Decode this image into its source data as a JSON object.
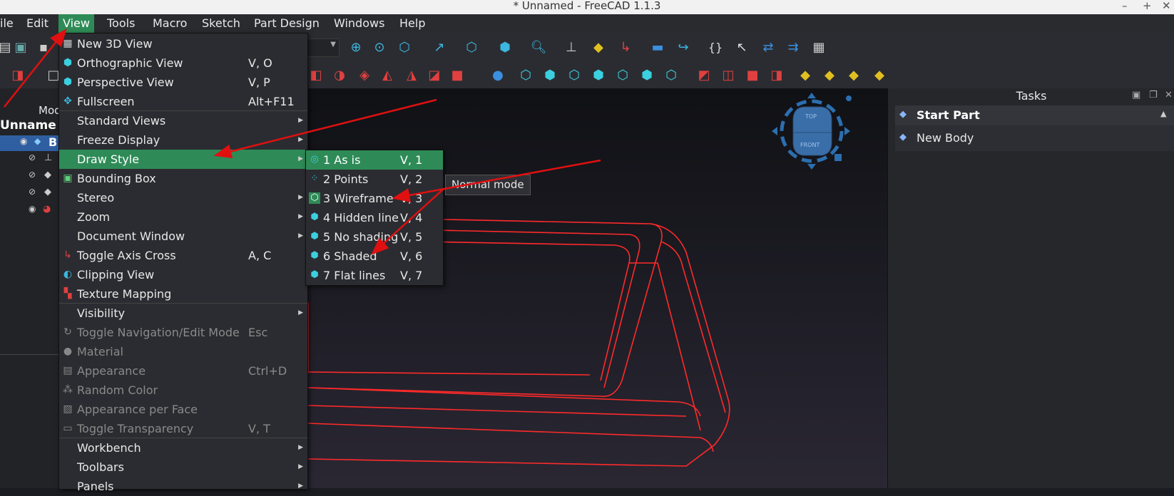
{
  "window": {
    "title": "* Unnamed - FreeCAD 1.1.3"
  },
  "menubar": {
    "items": [
      "ile",
      "Edit",
      "View",
      "Tools",
      "Macro",
      "Sketch",
      "Part Design",
      "Windows",
      "Help"
    ]
  },
  "left_panel": {
    "tab_fragment": "Mod",
    "doc_label": "Unname",
    "row_label": "B"
  },
  "tasks": {
    "header": "Tasks",
    "section_title": "Start Part",
    "action": "New Body"
  },
  "navcube": {
    "top_label": "TOP",
    "front_label": "FRONT"
  },
  "view_menu": {
    "items": [
      {
        "label": "New 3D View",
        "shortcut": "",
        "icon": "new-3d-view-icon",
        "disabled": false,
        "submenu": false
      },
      {
        "label": "Orthographic View",
        "shortcut": "V, O",
        "icon": "cube-icon",
        "disabled": false,
        "submenu": false
      },
      {
        "label": "Perspective View",
        "shortcut": "V, P",
        "icon": "cube-icon",
        "disabled": false,
        "submenu": false
      },
      {
        "label": "Fullscreen",
        "shortcut": "Alt+F11",
        "icon": "fullscreen-icon",
        "disabled": false,
        "submenu": false
      },
      {
        "label": "Standard Views",
        "shortcut": "",
        "icon": "",
        "disabled": false,
        "submenu": true
      },
      {
        "label": "Freeze Display",
        "shortcut": "",
        "icon": "",
        "disabled": false,
        "submenu": true
      },
      {
        "label": "Draw Style",
        "shortcut": "",
        "icon": "",
        "disabled": false,
        "submenu": true
      },
      {
        "label": "Bounding Box",
        "shortcut": "",
        "icon": "bounding-box-icon",
        "disabled": false,
        "submenu": false
      },
      {
        "label": "Stereo",
        "shortcut": "",
        "icon": "",
        "disabled": false,
        "submenu": true
      },
      {
        "label": "Zoom",
        "shortcut": "",
        "icon": "",
        "disabled": false,
        "submenu": true
      },
      {
        "label": "Document Window",
        "shortcut": "",
        "icon": "",
        "disabled": false,
        "submenu": true
      },
      {
        "label": "Toggle Axis Cross",
        "shortcut": "A, C",
        "icon": "axis-cross-icon",
        "disabled": false,
        "submenu": false
      },
      {
        "label": "Clipping View",
        "shortcut": "",
        "icon": "clipping-icon",
        "disabled": false,
        "submenu": false
      },
      {
        "label": "Texture Mapping",
        "shortcut": "",
        "icon": "texture-icon",
        "disabled": false,
        "submenu": false
      },
      {
        "label": "Visibility",
        "shortcut": "",
        "icon": "",
        "disabled": false,
        "submenu": true
      },
      {
        "label": "Toggle Navigation/Edit Mode",
        "shortcut": "Esc",
        "icon": "navigation-icon",
        "disabled": true,
        "submenu": false
      },
      {
        "label": "Material",
        "shortcut": "",
        "icon": "material-icon",
        "disabled": true,
        "submenu": false
      },
      {
        "label": "Appearance",
        "shortcut": "Ctrl+D",
        "icon": "appearance-icon",
        "disabled": true,
        "submenu": false
      },
      {
        "label": "Random Color",
        "shortcut": "",
        "icon": "random-color-icon",
        "disabled": true,
        "submenu": false
      },
      {
        "label": "Appearance per Face",
        "shortcut": "",
        "icon": "appearance-face-icon",
        "disabled": true,
        "submenu": false
      },
      {
        "label": "Toggle Transparency",
        "shortcut": "V, T",
        "icon": "transparency-icon",
        "disabled": true,
        "submenu": false
      },
      {
        "label": "Workbench",
        "shortcut": "",
        "icon": "",
        "disabled": false,
        "submenu": true
      },
      {
        "label": "Toolbars",
        "shortcut": "",
        "icon": "",
        "disabled": false,
        "submenu": true
      },
      {
        "label": "Panels",
        "shortcut": "",
        "icon": "",
        "disabled": false,
        "submenu": true
      }
    ]
  },
  "draw_style_menu": {
    "items": [
      {
        "label": "1 As is",
        "shortcut": "V, 1",
        "icon": "as-is-icon"
      },
      {
        "label": "2 Points",
        "shortcut": "V, 2",
        "icon": "points-icon"
      },
      {
        "label": "3 Wireframe",
        "shortcut": "V, 3",
        "icon": "wireframe-icon"
      },
      {
        "label": "4 Hidden line",
        "shortcut": "V, 4",
        "icon": "hidden-line-icon"
      },
      {
        "label": "5 No shading",
        "shortcut": "V, 5",
        "icon": "no-shading-icon"
      },
      {
        "label": "6 Shaded",
        "shortcut": "V, 6",
        "icon": "shaded-icon"
      },
      {
        "label": "7 Flat lines",
        "shortcut": "V, 7",
        "icon": "flat-lines-icon"
      }
    ]
  },
  "tooltip": "Normal mode",
  "colors": {
    "accent": "#2e8b57",
    "wireframe": "#ff2a2a",
    "annotation_arrow": "#e01010"
  }
}
